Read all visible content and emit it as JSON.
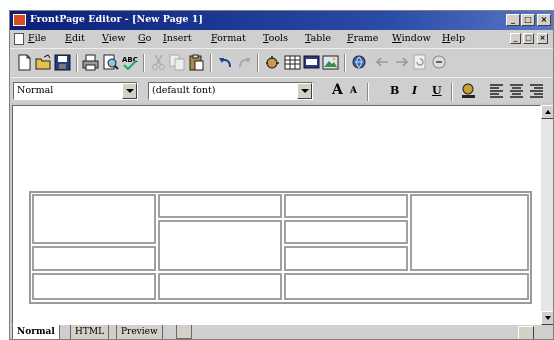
{
  "window": {
    "title": "FrontPage Editor - [New Page 1]"
  },
  "menubar": {
    "items": [
      {
        "label": "File"
      },
      {
        "label": "Edit"
      },
      {
        "label": "View"
      },
      {
        "label": "Go"
      },
      {
        "label": "Insert"
      },
      {
        "label": "Format"
      },
      {
        "label": "Tools"
      },
      {
        "label": "Table"
      },
      {
        "label": "Frame"
      },
      {
        "label": "Window"
      },
      {
        "label": "Help"
      }
    ]
  },
  "format_toolbar": {
    "style_value": "Normal",
    "font_value": "(default font)",
    "increase_font_label": "A",
    "decrease_font_label": "A",
    "bold_label": "B",
    "italic_label": "I",
    "underline_label": "U"
  },
  "tabs": [
    {
      "label": "Normal"
    },
    {
      "label": "HTML"
    },
    {
      "label": "Preview"
    }
  ]
}
